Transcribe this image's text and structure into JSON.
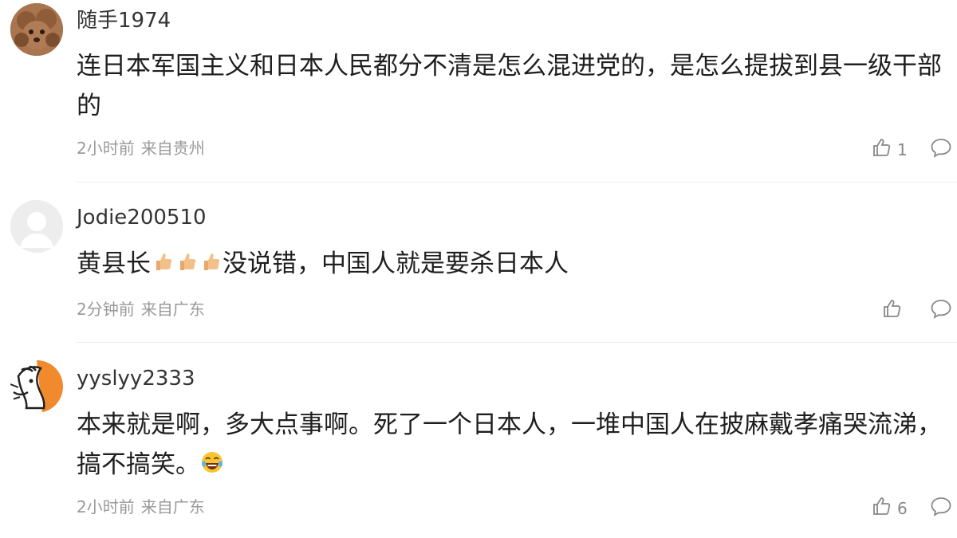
{
  "comments": [
    {
      "username": "随手1974",
      "content": "连日本军国主义和日本人民都分不清是怎么混进党的，是怎么提拔到县一级干部的",
      "time": "2小时前",
      "location": "来自贵州",
      "likes": "1",
      "avatar": "poodle-dog-photo"
    },
    {
      "username": "Jodie200510",
      "content_before_emoji": "黄县长",
      "content_after_emoji": "没说错，中国人就是要杀日本人",
      "emoji": "thumbs-up-icon",
      "emoji_count": 3,
      "time": "2分钟前",
      "location": "来自广东",
      "likes": "",
      "avatar": "default-user-avatar"
    },
    {
      "username": "yyslyy2333",
      "content": "本来就是啊，多大点事啊。死了一个日本人，一堆中国人在披麻戴孝痛哭流涕，搞不搞笑。",
      "emoji": "laughing-tears-emoji",
      "time": "2小时前",
      "location": "来自广东",
      "likes": "6",
      "avatar": "horse-illustration"
    }
  ],
  "colors": {
    "text": "#1f1f1f",
    "username": "#333333",
    "meta": "#9a9a9a",
    "icon": "#888888",
    "divider": "#ececec"
  }
}
